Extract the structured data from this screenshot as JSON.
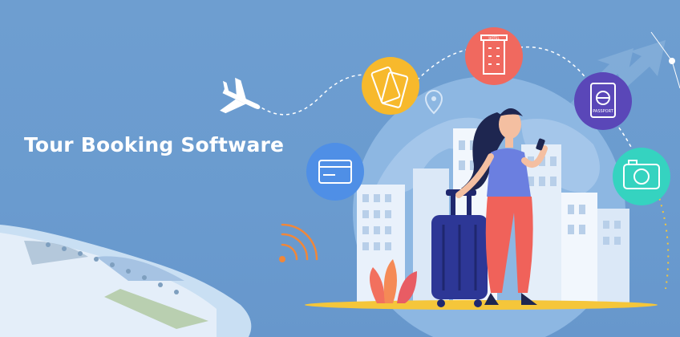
{
  "banner": {
    "headline": "Tour Booking Software",
    "icons": [
      "plane-icon",
      "flight-ticket-icon",
      "hotel-icon",
      "passport-icon",
      "camera-icon",
      "credit-card-icon",
      "location-pin-icon",
      "wifi-signal-icon"
    ],
    "badge_texts": {
      "hotel": "HOTEL",
      "passport": "PASSPORT"
    }
  },
  "colors": {
    "background": "#6f9fd0",
    "ticket_badge": "#f7b92c",
    "hotel_badge": "#f0695f",
    "passport_badge": "#5a47b8",
    "camera_badge": "#35d3c0",
    "card_badge": "#4f8fe6",
    "suitcase": "#2d3796",
    "dress_pants": "#f0625a",
    "shirt": "#6b7fe0",
    "floor_shadow": "#f5c63a"
  }
}
